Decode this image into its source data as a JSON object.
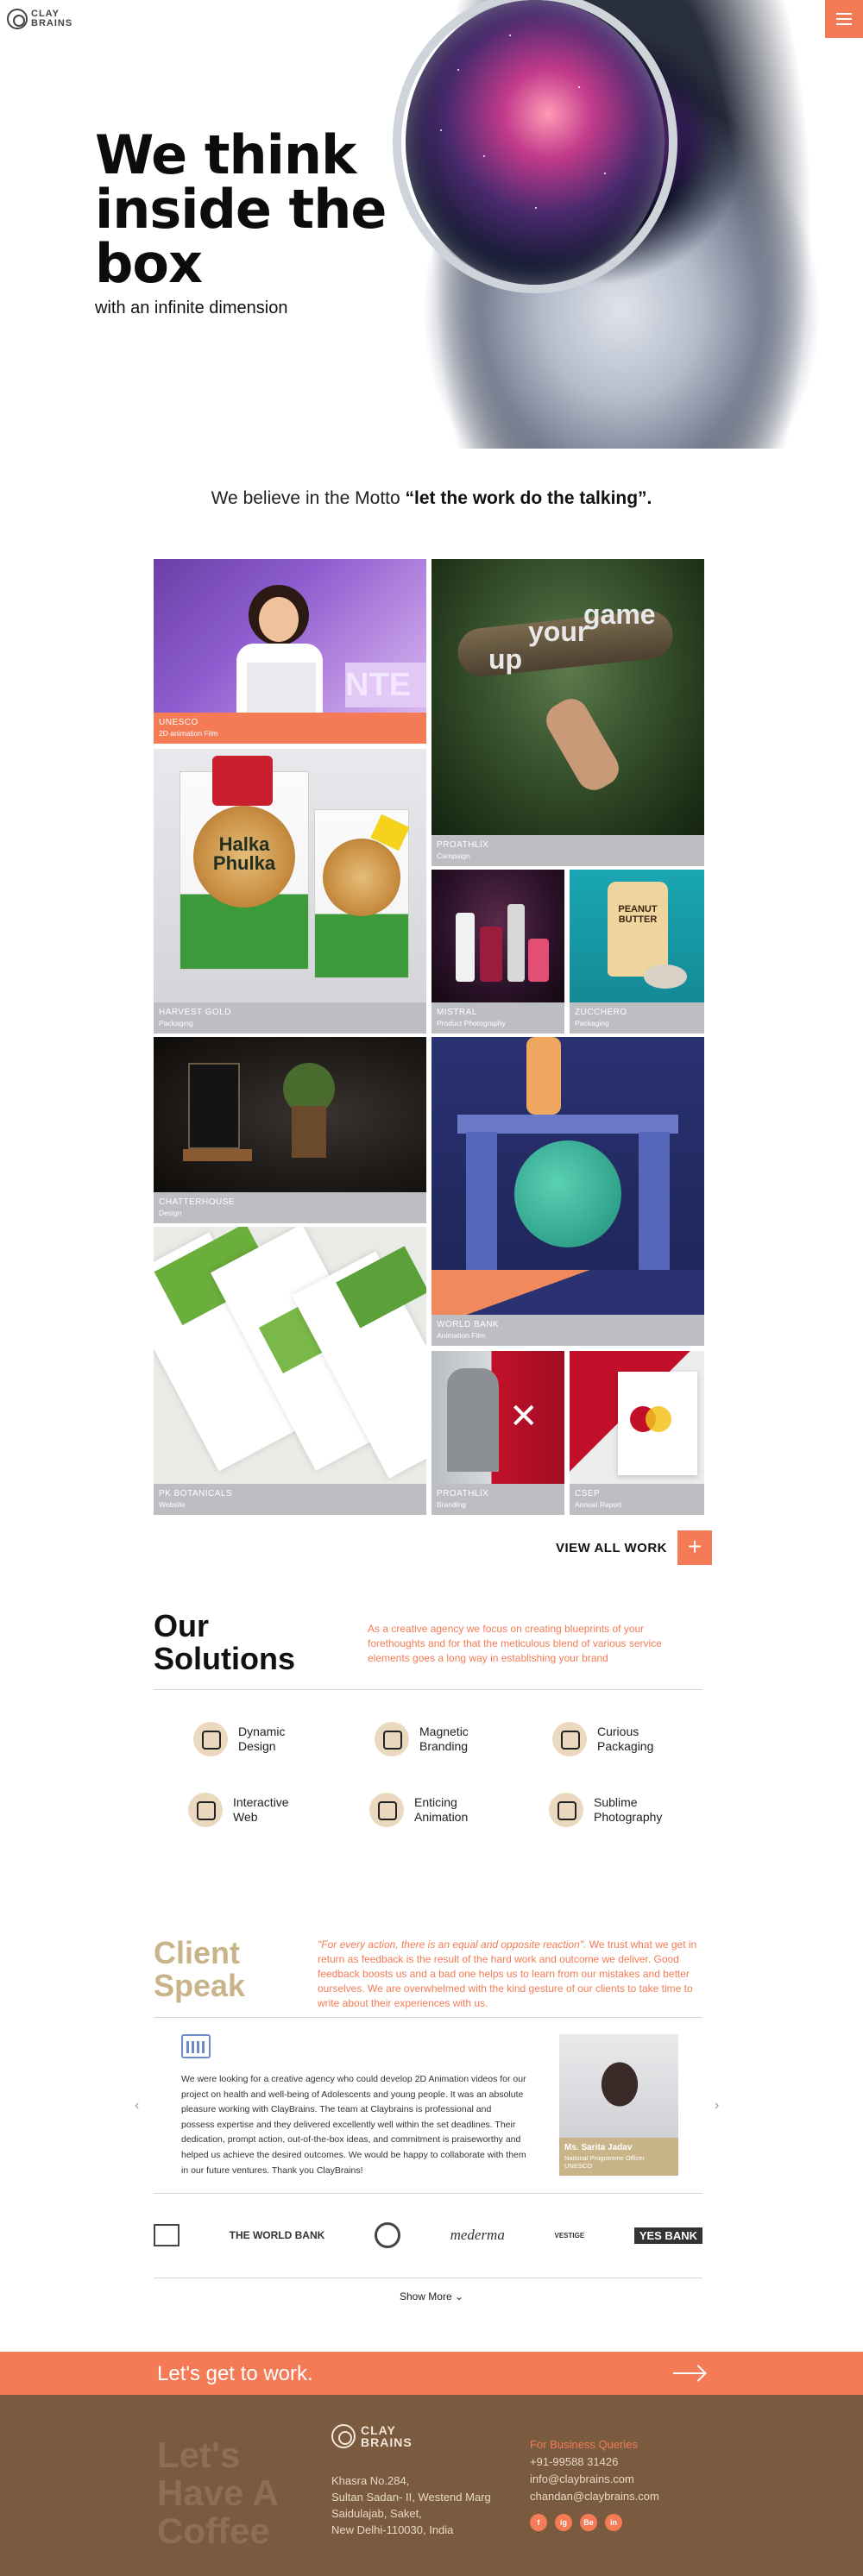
{
  "header": {
    "logo_text": "CLAY BRAINS",
    "menu_icon": "hamburger-icon"
  },
  "hero": {
    "title": "We think inside the box",
    "subtitle": "with an infinite dimension"
  },
  "motto": {
    "lead": "We believe in the Motto",
    "quote": "“let the work do the talking”."
  },
  "work": {
    "tiles": [
      {
        "title": "UNESCO",
        "subtitle": "2D animation Film"
      },
      {
        "title": "PROATHLIX",
        "subtitle": "Campaign",
        "art_text_1": "your",
        "art_text_2": "game",
        "art_text_3": "up"
      },
      {
        "title": "HARVEST GOLD",
        "subtitle": "Packaging",
        "art_text": "Halka Phulka"
      },
      {
        "title": "MISTRAL",
        "subtitle": "Product Photography"
      },
      {
        "title": "ZUCCHERO",
        "subtitle": "Packaging",
        "art_text": "PEANUT BUTTER"
      },
      {
        "title": "CHATTERHOUSE",
        "subtitle": "Design"
      },
      {
        "title": "WORLD BANK",
        "subtitle": "Animation Film"
      },
      {
        "title": "PK BOTANICALS",
        "subtitle": "Website"
      },
      {
        "title": "PROATHLIX",
        "subtitle": "Branding"
      },
      {
        "title": "CSEP",
        "subtitle": "Annual Report"
      }
    ],
    "view_all_label": "VIEW ALL WORK",
    "view_all_icon": "+"
  },
  "solutions": {
    "heading": "Our Solutions",
    "description": "As a creative agency we focus on creating blueprints of your forethoughts and for that the meticulous blend of various service elements goes a long way in establishing your brand",
    "items": [
      {
        "label": "Dynamic Design",
        "icon": "design-icon"
      },
      {
        "label": "Magnetic Branding",
        "icon": "bulb-icon"
      },
      {
        "label": "Curious Packaging",
        "icon": "box-icon"
      },
      {
        "label": "Interactive Web",
        "icon": "web-icon"
      },
      {
        "label": "Enticing Animation",
        "icon": "animation-icon"
      },
      {
        "label": "Sublime Photography",
        "icon": "camera-icon"
      }
    ]
  },
  "client_speak": {
    "heading": "Client Speak",
    "description_italic": "\"For every action, there is an equal and opposite reaction\".",
    "description_rest": "We trust what we get in return as feedback is the result of the hard work and outcome we deliver. Good feedback boosts us and a bad one helps us to learn from our mistakes and better ourselves. We are overwhelmed with the kind gesture of our clients to take time to write about their experiences with us.",
    "testimonial": {
      "text": "We were looking for a creative agency who could develop 2D Animation videos for our project on health and well-being of Adolescents and young people. It was an absolute pleasure working with ClayBrains. The team at Claybrains is professional and possess expertise and they delivered excellently well within the set deadlines. Their dedication, prompt action, out-of-the-box ideas, and commitment is praiseworthy and helped us achieve the desired outcomes. We would be happy to collaborate with them in our future ventures. Thank you ClayBrains!",
      "name": "Ms. Sarita Jadav",
      "role": "National Programme Officer UNESCO"
    },
    "clients": [
      "THE WORLD BANK",
      "mederma",
      "VESTIGE",
      "YES BANK"
    ],
    "show_more": "Show More ⌄"
  },
  "cta": {
    "text": "Let's get to work."
  },
  "footer": {
    "coffee": "Let's Have A Coffee",
    "logo_text": "CLAY BRAINS",
    "address": [
      "Khasra No.284,",
      "Sultan Sadan- II, Westend Marg",
      "Saidulajab, Saket,",
      "New Delhi-110030, India"
    ],
    "contact_heading": "For Business Queries",
    "phone": "+91-99588 31426",
    "email1": "info@claybrains.com",
    "email2": "chandan@claybrains.com",
    "socials": [
      "f",
      "ig",
      "Be",
      "in"
    ]
  },
  "colors": {
    "accent": "#f47b56",
    "gold": "#c9b489",
    "footer_bg": "#7a5b40"
  }
}
